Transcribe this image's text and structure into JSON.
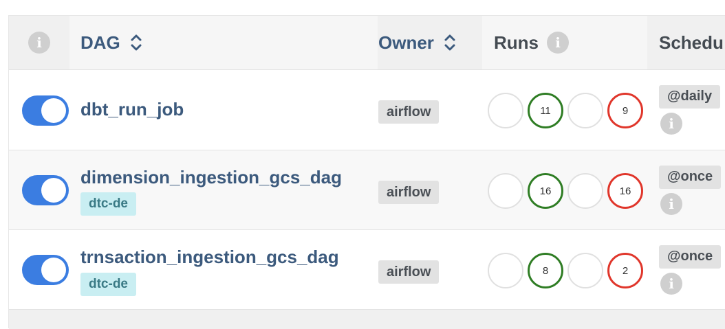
{
  "header": {
    "col_info_icon": "info-icon",
    "dag_label": "DAG",
    "owner_label": "Owner",
    "runs_label": "Runs",
    "schedule_label": "Schedu"
  },
  "rows": [
    {
      "enabled": true,
      "name": "dbt_run_job",
      "tag": "",
      "owner": "airflow",
      "runs": {
        "queued": "",
        "success": "11",
        "running": "",
        "failed": "9"
      },
      "schedule": "@daily"
    },
    {
      "enabled": true,
      "name": "dimension_ingestion_gcs_dag",
      "tag": "dtc-de",
      "owner": "airflow",
      "runs": {
        "queued": "",
        "success": "16",
        "running": "",
        "failed": "16"
      },
      "schedule": "@once"
    },
    {
      "enabled": true,
      "name": "trnsaction_ingestion_gcs_dag",
      "tag": "dtc-de",
      "owner": "airflow",
      "runs": {
        "queued": "",
        "success": "8",
        "running": "",
        "failed": "2"
      },
      "schedule": "@once"
    }
  ],
  "colors": {
    "toggle_on": "#3b7de1",
    "success": "#2f7d24",
    "failed": "#e0362b",
    "link": "#3c5a7d",
    "tag_bg": "#c9eef2"
  }
}
